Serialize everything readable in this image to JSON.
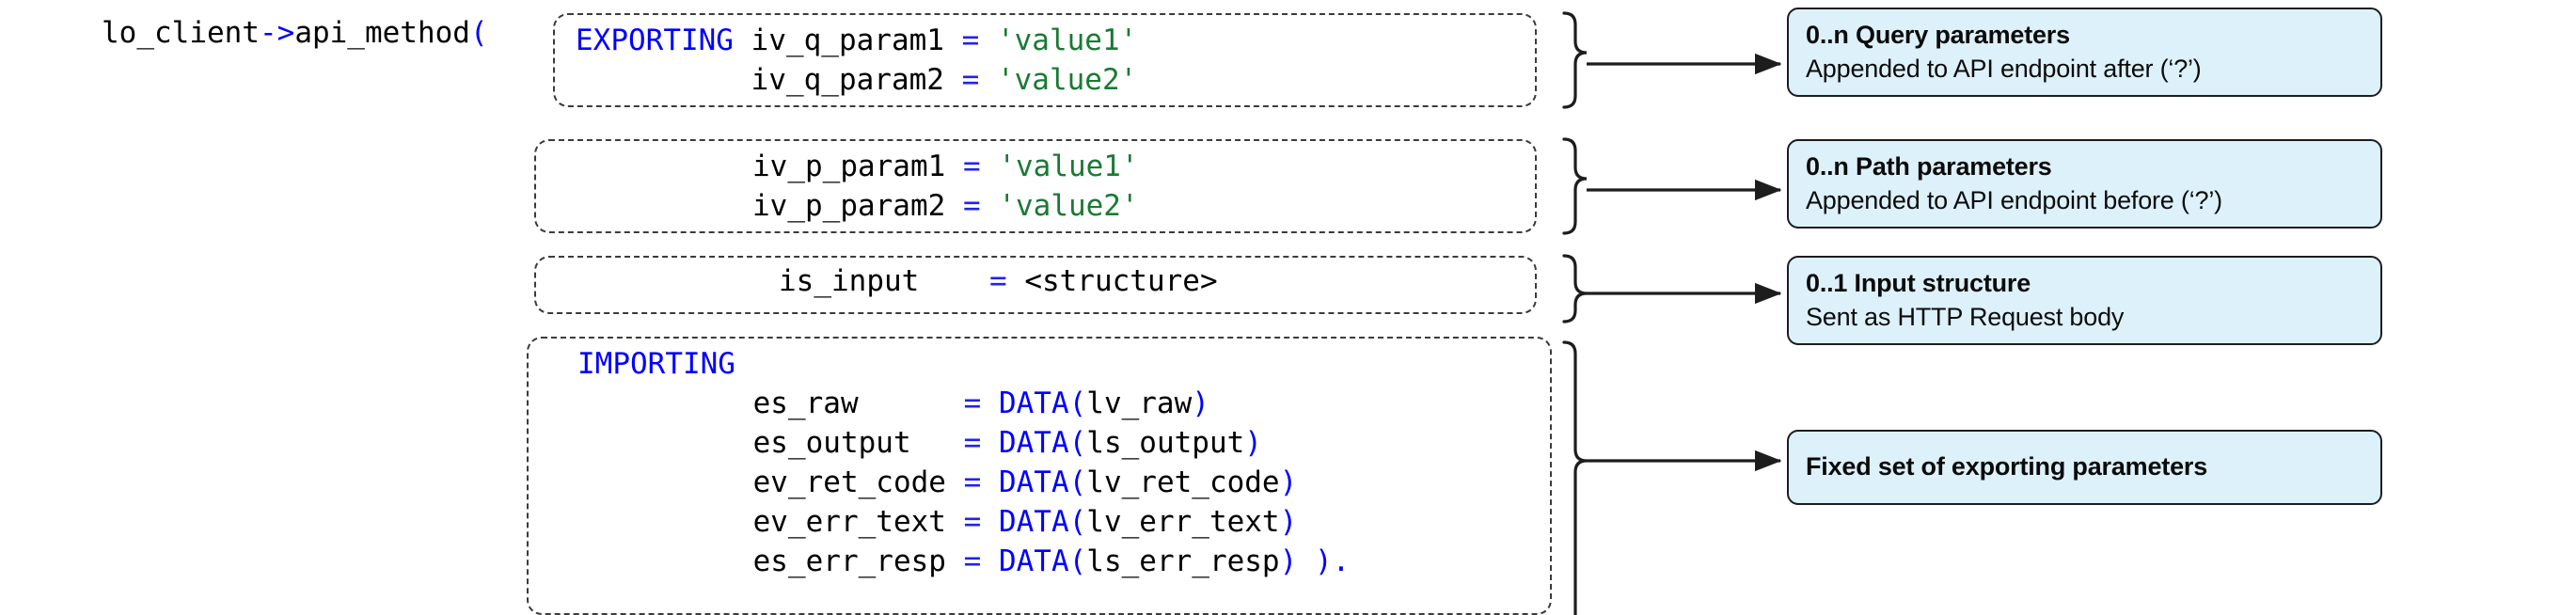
{
  "diagram": {
    "call_statement": {
      "receiver": "lo_client",
      "arrow": "->",
      "method": "api_method",
      "open_paren": "("
    },
    "boxes": [
      {
        "id": "query",
        "keyword": "EXPORTING",
        "lines": [
          {
            "name": "iv_q_param1",
            "operator": "=",
            "value": "'value1'",
            "value_kind": "string"
          },
          {
            "name": "iv_q_param2",
            "operator": "=",
            "value": "'value2'",
            "value_kind": "string"
          }
        ]
      },
      {
        "id": "path",
        "keyword": "",
        "lines": [
          {
            "name": "iv_p_param1",
            "operator": "=",
            "value": "'value1'",
            "value_kind": "string"
          },
          {
            "name": "iv_p_param2",
            "operator": "=",
            "value": "'value2'",
            "value_kind": "string"
          }
        ]
      },
      {
        "id": "input",
        "keyword": "",
        "lines": [
          {
            "name": "is_input",
            "operator": "=",
            "value": "<structure>",
            "value_kind": "plain"
          }
        ]
      },
      {
        "id": "importing",
        "keyword": "IMPORTING",
        "lines": [
          {
            "name": "es_raw",
            "operator": "=",
            "value": "DATA(lv_raw)",
            "value_kind": "data",
            "inner": "lv_raw"
          },
          {
            "name": "es_output",
            "operator": "=",
            "value": "DATA(ls_output)",
            "value_kind": "data",
            "inner": "ls_output"
          },
          {
            "name": "ev_ret_code",
            "operator": "=",
            "value": "DATA(lv_ret_code)",
            "value_kind": "data",
            "inner": "lv_ret_code"
          },
          {
            "name": "ev_err_text",
            "operator": "=",
            "value": "DATA(lv_err_text)",
            "value_kind": "data",
            "inner": "lv_err_text"
          },
          {
            "name": "es_err_resp",
            "operator": "=",
            "value": "DATA(ls_err_resp)",
            "value_kind": "data",
            "inner": "ls_err_resp",
            "terminator": ")."
          }
        ]
      }
    ],
    "code_text": {
      "query_block": "EXPORTING iv_q_param1 = 'value1'\n          iv_q_param2 = 'value2'",
      "path_block": "iv_p_param1 = 'value1'\niv_p_param2 = 'value2'",
      "input_block": "is_input    = <structure>",
      "importing_block": "IMPORTING\n          es_raw      = DATA(lv_raw)\n          es_output   = DATA(ls_output)\n          ev_ret_code = DATA(lv_ret_code)\n          ev_err_text = DATA(lv_err_text)\n          es_err_resp = DATA(ls_err_resp) )."
    },
    "callouts": [
      {
        "id": "query",
        "title": "0..n Query parameters",
        "subtitle": "Appended to API endpoint after (‘?’)"
      },
      {
        "id": "path",
        "title": "0..n Path parameters",
        "subtitle": "Appended to API endpoint before (‘?’)"
      },
      {
        "id": "input",
        "title": "0..1 Input structure",
        "subtitle": "Sent as HTTP Request body"
      },
      {
        "id": "fixed",
        "title": "Fixed set of exporting parameters",
        "subtitle": ""
      }
    ],
    "colors": {
      "keyword": "#0000ff",
      "string": "#1a7a33",
      "operator": "#2222ee",
      "callout_fill": "#ddf1fb",
      "callout_border": "#1d1d1d",
      "box_border": "#3b3b3b",
      "text": "#000000",
      "background": "#ffffff"
    }
  }
}
